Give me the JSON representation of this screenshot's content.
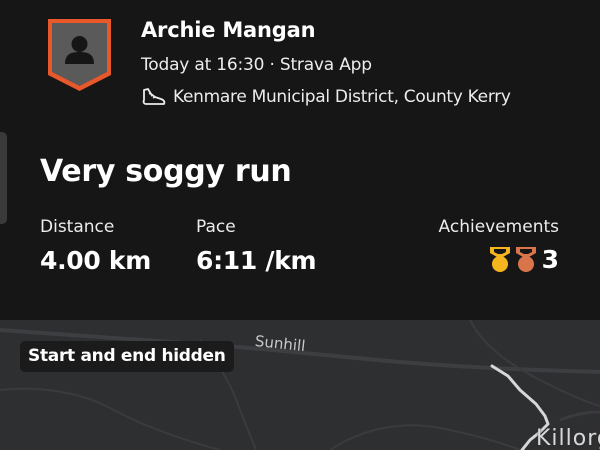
{
  "athlete": {
    "name": "Archie Mangan",
    "timestamp": "Today at 16:30 · Strava App",
    "location": "Kenmare Municipal District, County Kerry"
  },
  "activity": {
    "title": "Very soggy run"
  },
  "stats": {
    "distance_label": "Distance",
    "distance_value": "4.00 km",
    "pace_label": "Pace",
    "pace_value": "6:11 /km",
    "achievements_label": "Achievements",
    "achievements_count": "3"
  },
  "map": {
    "privacy_label": "Start and end hidden",
    "road_label": "Sunhill",
    "town_label": "Killorg"
  },
  "colors": {
    "badge_orange": "#e8582a",
    "medal_gold": "#f5b51f",
    "medal_bronze": "#d9754a",
    "background": "#161616",
    "map_background": "#2e2f31"
  },
  "icons": [
    "avatar-icon",
    "shoe-icon",
    "gold-medal-icon",
    "bronze-medal-icon"
  ]
}
